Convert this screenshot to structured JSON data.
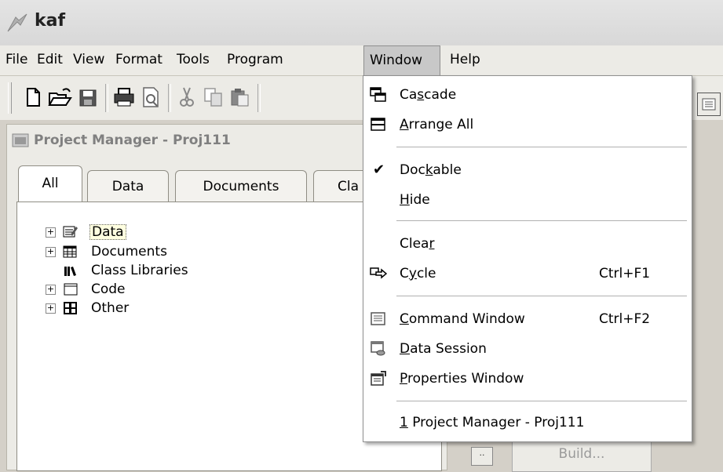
{
  "app": {
    "title": "kaf"
  },
  "menubar": {
    "items": [
      {
        "label": "File"
      },
      {
        "label": "Edit"
      },
      {
        "label": "View"
      },
      {
        "label": "Format"
      },
      {
        "label": "Tools"
      },
      {
        "label": "Program"
      },
      {
        "label": "Window"
      },
      {
        "label": "Help"
      }
    ]
  },
  "toolbar": {
    "buttons": [
      "new-file-icon",
      "open-folder-icon",
      "save-icon",
      "print-icon",
      "print-preview-icon",
      "cut-icon",
      "copy-icon",
      "paste-icon"
    ]
  },
  "project_manager": {
    "title": "Project Manager - Proj111",
    "tabs": [
      {
        "label": "All"
      },
      {
        "label": "Data"
      },
      {
        "label": "Documents"
      },
      {
        "label": "Cla"
      }
    ],
    "tree": [
      {
        "label": "Data",
        "expandable": true,
        "selected": true
      },
      {
        "label": "Documents",
        "expandable": true
      },
      {
        "label": "Class Libraries",
        "expandable": false
      },
      {
        "label": "Code",
        "expandable": true
      },
      {
        "label": "Other",
        "expandable": true
      }
    ],
    "build_label": "Build..."
  },
  "window_menu": {
    "cascade": {
      "pre": "Ca",
      "u": "s",
      "post": "cade"
    },
    "arrange": {
      "pre": "",
      "u": "A",
      "post": "rrange All"
    },
    "dockable": {
      "pre": "Doc",
      "u": "k",
      "post": "able",
      "checked": true
    },
    "hide": {
      "pre": "",
      "u": "H",
      "post": "ide"
    },
    "clear": {
      "pre": "Clea",
      "u": "r",
      "post": ""
    },
    "cycle": {
      "pre": "C",
      "u": "y",
      "post": "cle",
      "shortcut": "Ctrl+F1"
    },
    "command": {
      "pre": "",
      "u": "C",
      "post": "ommand Window",
      "shortcut": "Ctrl+F2"
    },
    "datasession": {
      "pre": "",
      "u": "D",
      "post": "ata Session"
    },
    "properties": {
      "pre": "",
      "u": "P",
      "post": "roperties Window"
    },
    "recent": {
      "pre": "",
      "u": "1",
      "post": " Project Manager - Proj111"
    }
  }
}
